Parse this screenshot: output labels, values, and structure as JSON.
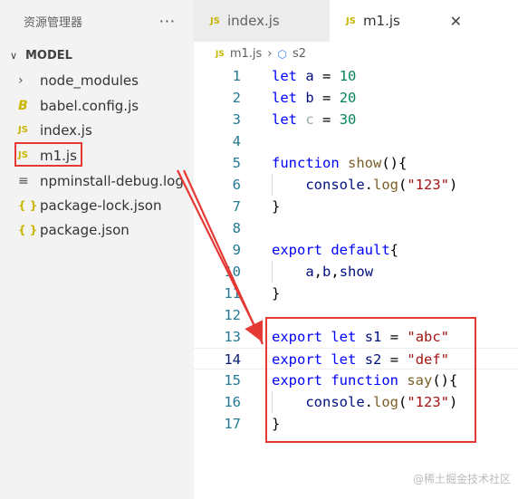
{
  "sidebar": {
    "title": "资源管理器",
    "more_glyph": "···",
    "section": {
      "chevron": "∨",
      "label": "MODEL"
    },
    "items": [
      {
        "icon": "›",
        "label": "node_modules"
      },
      {
        "icon": "B",
        "label": "babel.config.js"
      },
      {
        "icon": "JS",
        "label": "index.js"
      },
      {
        "icon": "JS",
        "label": "m1.js"
      },
      {
        "icon": "≡",
        "label": "npminstall-debug.log"
      },
      {
        "icon": "{ }",
        "label": "package-lock.json"
      },
      {
        "icon": "{ }",
        "label": "package.json"
      }
    ]
  },
  "tabs": [
    {
      "icon": "JS",
      "label": "index.js"
    },
    {
      "icon": "JS",
      "label": "m1.js",
      "close": "✕"
    }
  ],
  "breadcrumb": {
    "icon": "JS",
    "file": "m1.js",
    "sep": "›",
    "symbol_icon": "⬡",
    "symbol": "s2"
  },
  "code": {
    "line_numbers": [
      "1",
      "2",
      "3",
      "4",
      "5",
      "6",
      "7",
      "8",
      "9",
      "10",
      "11",
      "12",
      "13",
      "14",
      "15",
      "16",
      "17"
    ],
    "current_line": 14
  },
  "watermark": "@稀土掘金技术社区",
  "colors": {
    "highlight_box": "#e53935",
    "keyword": "#0000ff",
    "string": "#a31515",
    "number": "#098658",
    "function": "#795e26"
  }
}
